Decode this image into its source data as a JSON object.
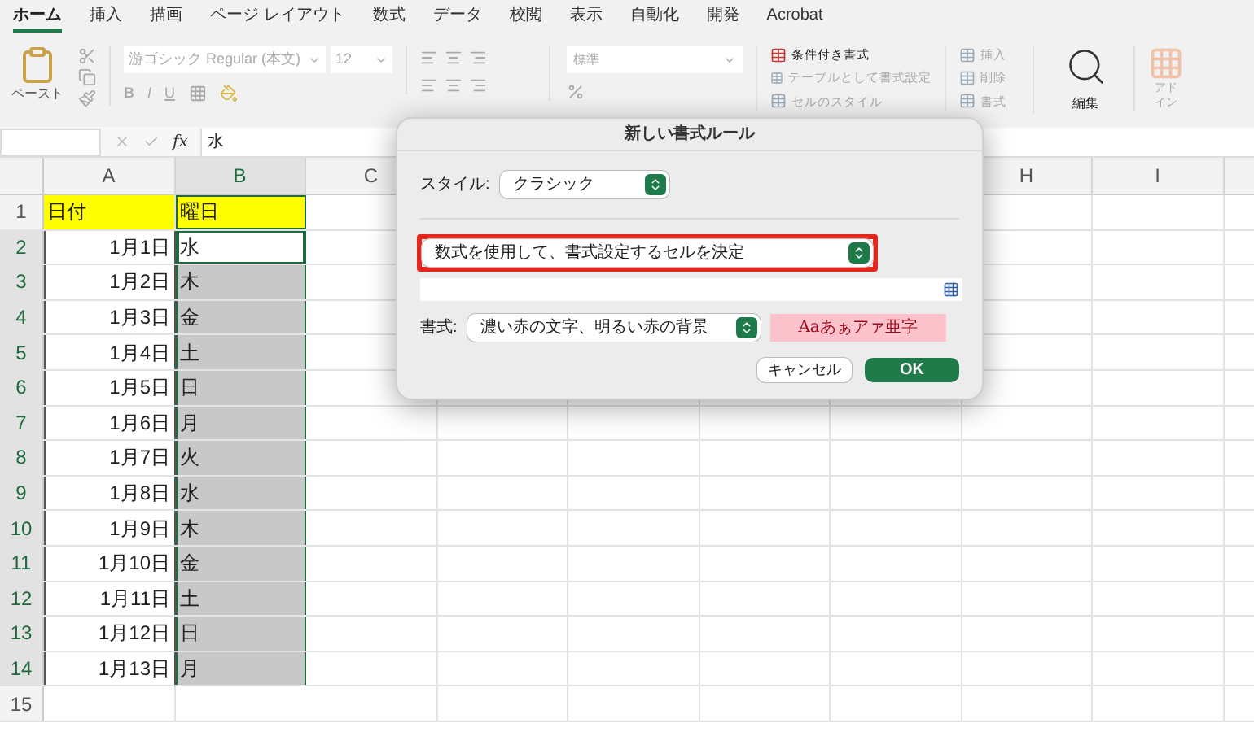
{
  "tabs": [
    {
      "label": "ホーム",
      "selected": true
    },
    {
      "label": "挿入",
      "selected": false
    },
    {
      "label": "描画",
      "selected": false
    },
    {
      "label": "ページ レイアウト",
      "selected": false
    },
    {
      "label": "数式",
      "selected": false
    },
    {
      "label": "データ",
      "selected": false
    },
    {
      "label": "校閲",
      "selected": false
    },
    {
      "label": "表示",
      "selected": false
    },
    {
      "label": "自動化",
      "selected": false
    },
    {
      "label": "開発",
      "selected": false
    },
    {
      "label": "Acrobat",
      "selected": false
    }
  ],
  "ribbon": {
    "paste_label": "ペースト",
    "font_name": "游ゴシック Regular (本文)",
    "font_size": "12",
    "bold": "B",
    "italic": "I",
    "underline": "U",
    "number_format": "標準",
    "styles": [
      "条件付き書式",
      "テーブルとして書式設定",
      "セルのスタイル"
    ],
    "cells": [
      "挿入",
      "削除",
      "書式"
    ],
    "editing_label": "編集",
    "addins_label": "アドイン"
  },
  "formula_bar": {
    "fx": "fx",
    "value": "水"
  },
  "columns": [
    "A",
    "B",
    "C",
    "H",
    "I"
  ],
  "rows": [
    {
      "number": "1",
      "date": "日付",
      "weekday": "曜日",
      "kind": "header",
      "selected": false,
      "active": false
    },
    {
      "number": "2",
      "date": "1月1日",
      "weekday": "水",
      "kind": "data",
      "selected": true,
      "active": true
    },
    {
      "number": "3",
      "date": "1月2日",
      "weekday": "木",
      "kind": "data",
      "selected": true,
      "active": false
    },
    {
      "number": "4",
      "date": "1月3日",
      "weekday": "金",
      "kind": "data",
      "selected": true,
      "active": false
    },
    {
      "number": "5",
      "date": "1月4日",
      "weekday": "土",
      "kind": "data",
      "selected": true,
      "active": false
    },
    {
      "number": "6",
      "date": "1月5日",
      "weekday": "日",
      "kind": "data",
      "selected": true,
      "active": false
    },
    {
      "number": "7",
      "date": "1月6日",
      "weekday": "月",
      "kind": "data",
      "selected": true,
      "active": false
    },
    {
      "number": "8",
      "date": "1月7日",
      "weekday": "火",
      "kind": "data",
      "selected": true,
      "active": false
    },
    {
      "number": "9",
      "date": "1月8日",
      "weekday": "水",
      "kind": "data",
      "selected": true,
      "active": false
    },
    {
      "number": "10",
      "date": "1月9日",
      "weekday": "木",
      "kind": "data",
      "selected": true,
      "active": false
    },
    {
      "number": "11",
      "date": "1月10日",
      "weekday": "金",
      "kind": "data",
      "selected": true,
      "active": false
    },
    {
      "number": "12",
      "date": "1月11日",
      "weekday": "土",
      "kind": "data",
      "selected": true,
      "active": false
    },
    {
      "number": "13",
      "date": "1月12日",
      "weekday": "日",
      "kind": "data",
      "selected": true,
      "active": false
    },
    {
      "number": "14",
      "date": "1月13日",
      "weekday": "月",
      "kind": "data",
      "selected": true,
      "active": false
    },
    {
      "number": "15",
      "kind": "empty",
      "selected": false,
      "active": false
    }
  ],
  "dialog": {
    "title": "新しい書式ルール",
    "style_label": "スタイル:",
    "style_value": "クラシック",
    "rule_type": "数式を使用して、書式設定するセルを決定",
    "rule_highlighted": true,
    "format_label": "書式:",
    "format_value": "濃い赤の文字、明るい赤の背景",
    "preview": "Aaあぁアァ亜字",
    "cancel": "キャンセル",
    "ok": "OK"
  }
}
